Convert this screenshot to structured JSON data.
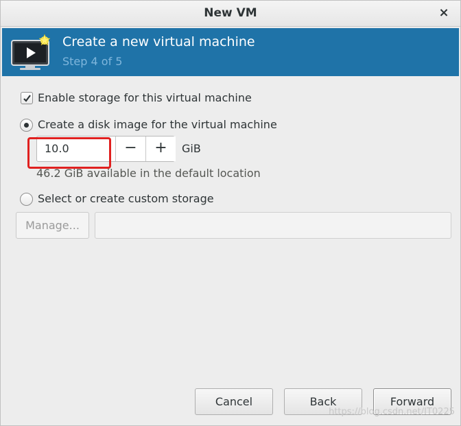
{
  "window": {
    "title": "New VM",
    "close_glyph": "×"
  },
  "banner": {
    "heading": "Create a new virtual machine",
    "step": "Step 4 of 5",
    "icon": "vm-monitor-icon",
    "background_color": "#1f73a8"
  },
  "storage": {
    "enable_label": "Enable storage for this virtual machine",
    "enable_checked": true,
    "disk_image_label": "Create a disk image for the virtual machine",
    "disk_image_selected": true,
    "size_value": "10.0",
    "decrement_glyph": "−",
    "increment_glyph": "+",
    "unit": "GiB",
    "available_hint": "46.2 GiB available in the default location",
    "custom_label": "Select or create custom storage",
    "custom_selected": false,
    "manage_label": "Manage...",
    "path_value": ""
  },
  "footer": {
    "cancel_label": "Cancel",
    "back_label": "Back",
    "forward_label": "Forward"
  },
  "watermark": "https://blog.csdn.net/IT0225",
  "colors": {
    "highlight": "#e0201f",
    "text": "#2e3436"
  }
}
